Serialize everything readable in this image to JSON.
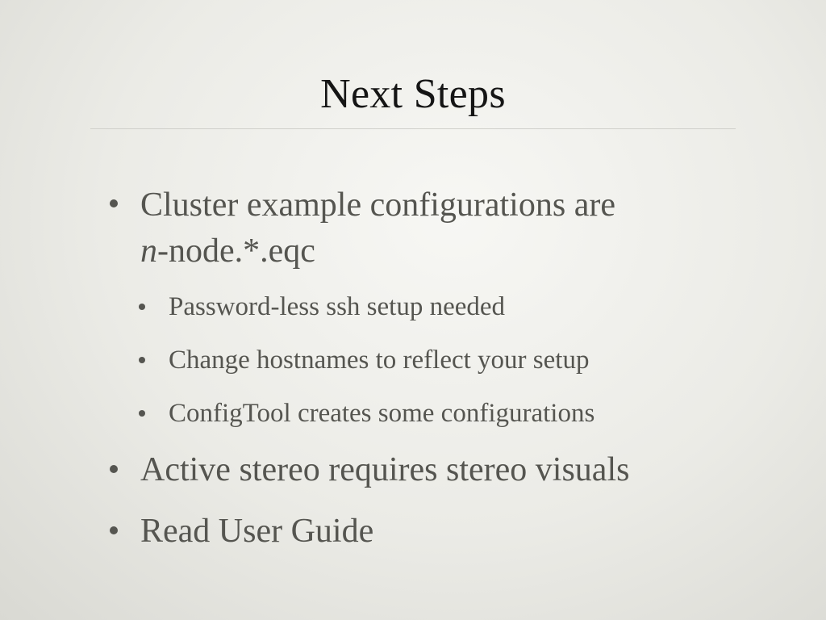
{
  "slide": {
    "title": "Next Steps",
    "bullets": [
      {
        "line1": "Cluster example configurations are",
        "line2_italic": "n",
        "line2_rest": "-node.*.eqc",
        "sub": [
          "Password-less ssh setup needed",
          "Change hostnames to reflect your setup",
          "ConfigTool creates some configurations"
        ]
      },
      {
        "text": "Active stereo requires stereo visuals"
      },
      {
        "text": "Read User Guide"
      }
    ]
  }
}
